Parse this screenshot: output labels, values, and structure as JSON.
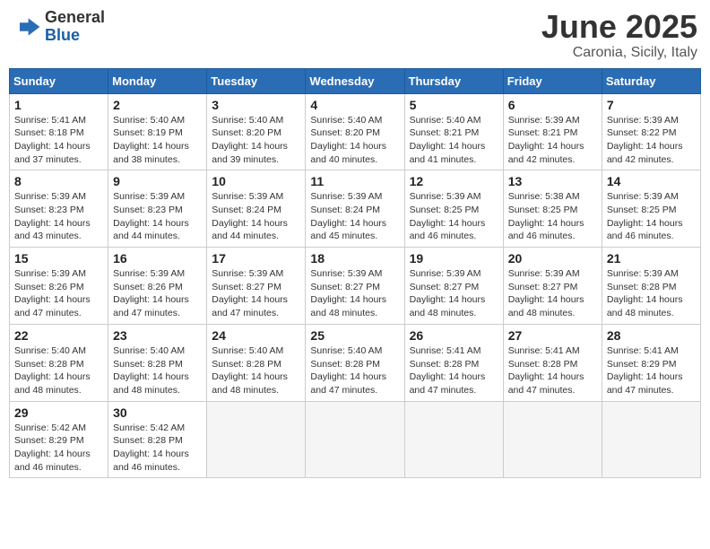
{
  "header": {
    "logo_general": "General",
    "logo_blue": "Blue",
    "month_title": "June 2025",
    "location": "Caronia, Sicily, Italy"
  },
  "calendar": {
    "days_of_week": [
      "Sunday",
      "Monday",
      "Tuesday",
      "Wednesday",
      "Thursday",
      "Friday",
      "Saturday"
    ],
    "weeks": [
      [
        {
          "day": null
        },
        {
          "day": 2,
          "sunrise": "5:40 AM",
          "sunset": "8:19 PM",
          "daylight": "14 hours and 38 minutes."
        },
        {
          "day": 3,
          "sunrise": "5:40 AM",
          "sunset": "8:20 PM",
          "daylight": "14 hours and 39 minutes."
        },
        {
          "day": 4,
          "sunrise": "5:40 AM",
          "sunset": "8:20 PM",
          "daylight": "14 hours and 40 minutes."
        },
        {
          "day": 5,
          "sunrise": "5:40 AM",
          "sunset": "8:21 PM",
          "daylight": "14 hours and 41 minutes."
        },
        {
          "day": 6,
          "sunrise": "5:39 AM",
          "sunset": "8:21 PM",
          "daylight": "14 hours and 42 minutes."
        },
        {
          "day": 7,
          "sunrise": "5:39 AM",
          "sunset": "8:22 PM",
          "daylight": "14 hours and 42 minutes."
        }
      ],
      [
        {
          "day": 1,
          "sunrise": "5:41 AM",
          "sunset": "8:18 PM",
          "daylight": "14 hours and 37 minutes."
        },
        {
          "day": null
        },
        {
          "day": null
        },
        {
          "day": null
        },
        {
          "day": null
        },
        {
          "day": null
        },
        {
          "day": null
        }
      ],
      [
        {
          "day": 8,
          "sunrise": "5:39 AM",
          "sunset": "8:23 PM",
          "daylight": "14 hours and 43 minutes."
        },
        {
          "day": 9,
          "sunrise": "5:39 AM",
          "sunset": "8:23 PM",
          "daylight": "14 hours and 44 minutes."
        },
        {
          "day": 10,
          "sunrise": "5:39 AM",
          "sunset": "8:24 PM",
          "daylight": "14 hours and 44 minutes."
        },
        {
          "day": 11,
          "sunrise": "5:39 AM",
          "sunset": "8:24 PM",
          "daylight": "14 hours and 45 minutes."
        },
        {
          "day": 12,
          "sunrise": "5:39 AM",
          "sunset": "8:25 PM",
          "daylight": "14 hours and 46 minutes."
        },
        {
          "day": 13,
          "sunrise": "5:38 AM",
          "sunset": "8:25 PM",
          "daylight": "14 hours and 46 minutes."
        },
        {
          "day": 14,
          "sunrise": "5:39 AM",
          "sunset": "8:25 PM",
          "daylight": "14 hours and 46 minutes."
        }
      ],
      [
        {
          "day": 15,
          "sunrise": "5:39 AM",
          "sunset": "8:26 PM",
          "daylight": "14 hours and 47 minutes."
        },
        {
          "day": 16,
          "sunrise": "5:39 AM",
          "sunset": "8:26 PM",
          "daylight": "14 hours and 47 minutes."
        },
        {
          "day": 17,
          "sunrise": "5:39 AM",
          "sunset": "8:27 PM",
          "daylight": "14 hours and 47 minutes."
        },
        {
          "day": 18,
          "sunrise": "5:39 AM",
          "sunset": "8:27 PM",
          "daylight": "14 hours and 48 minutes."
        },
        {
          "day": 19,
          "sunrise": "5:39 AM",
          "sunset": "8:27 PM",
          "daylight": "14 hours and 48 minutes."
        },
        {
          "day": 20,
          "sunrise": "5:39 AM",
          "sunset": "8:27 PM",
          "daylight": "14 hours and 48 minutes."
        },
        {
          "day": 21,
          "sunrise": "5:39 AM",
          "sunset": "8:28 PM",
          "daylight": "14 hours and 48 minutes."
        }
      ],
      [
        {
          "day": 22,
          "sunrise": "5:40 AM",
          "sunset": "8:28 PM",
          "daylight": "14 hours and 48 minutes."
        },
        {
          "day": 23,
          "sunrise": "5:40 AM",
          "sunset": "8:28 PM",
          "daylight": "14 hours and 48 minutes."
        },
        {
          "day": 24,
          "sunrise": "5:40 AM",
          "sunset": "8:28 PM",
          "daylight": "14 hours and 48 minutes."
        },
        {
          "day": 25,
          "sunrise": "5:40 AM",
          "sunset": "8:28 PM",
          "daylight": "14 hours and 47 minutes."
        },
        {
          "day": 26,
          "sunrise": "5:41 AM",
          "sunset": "8:28 PM",
          "daylight": "14 hours and 47 minutes."
        },
        {
          "day": 27,
          "sunrise": "5:41 AM",
          "sunset": "8:28 PM",
          "daylight": "14 hours and 47 minutes."
        },
        {
          "day": 28,
          "sunrise": "5:41 AM",
          "sunset": "8:29 PM",
          "daylight": "14 hours and 47 minutes."
        }
      ],
      [
        {
          "day": 29,
          "sunrise": "5:42 AM",
          "sunset": "8:29 PM",
          "daylight": "14 hours and 46 minutes."
        },
        {
          "day": 30,
          "sunrise": "5:42 AM",
          "sunset": "8:28 PM",
          "daylight": "14 hours and 46 minutes."
        },
        {
          "day": null
        },
        {
          "day": null
        },
        {
          "day": null
        },
        {
          "day": null
        },
        {
          "day": null
        }
      ]
    ]
  }
}
